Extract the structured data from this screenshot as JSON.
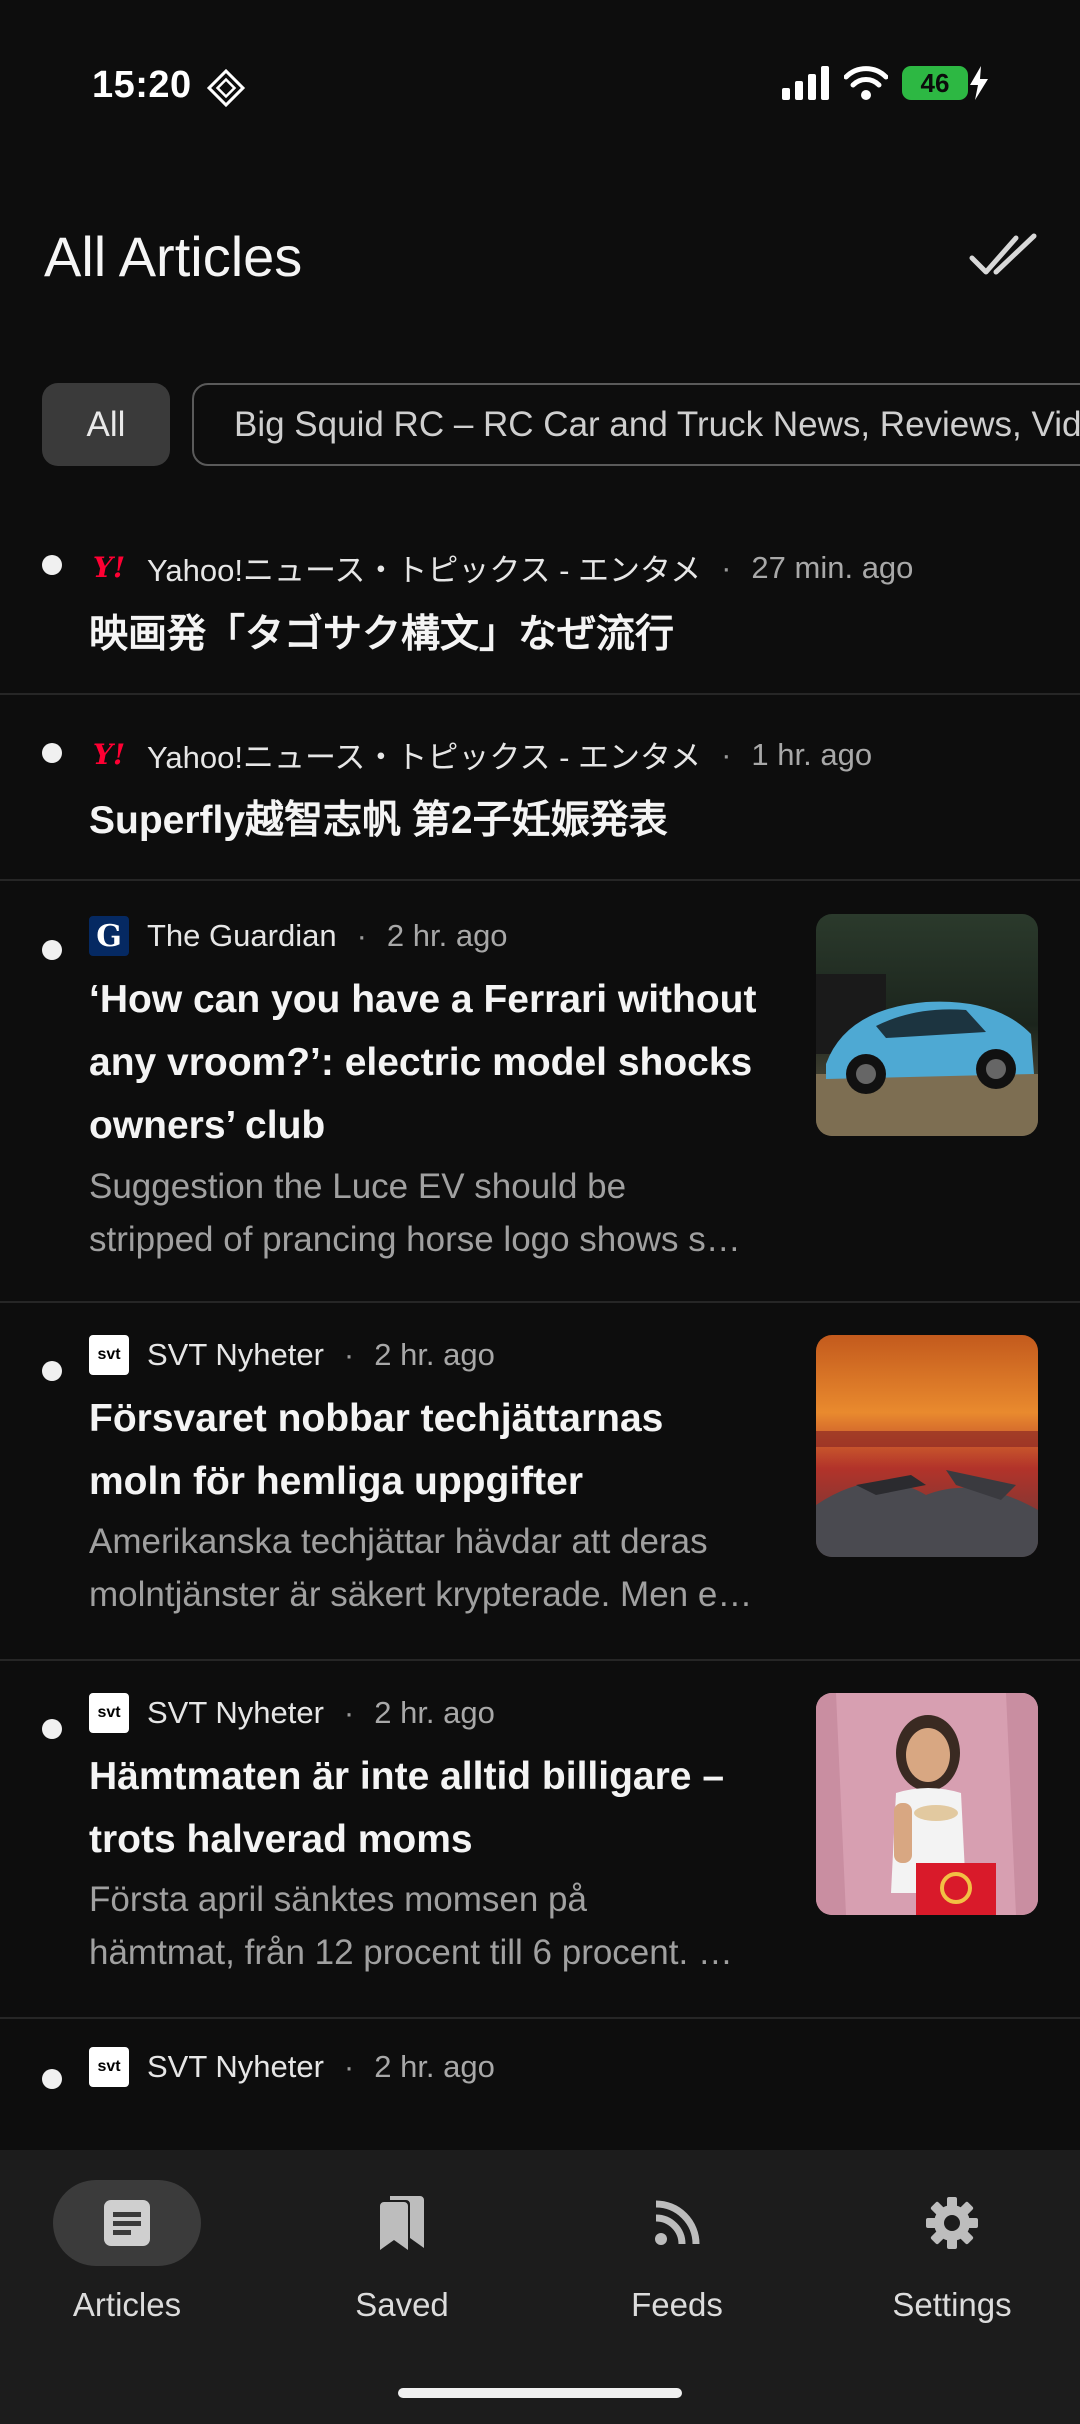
{
  "status_bar": {
    "time": "15:20",
    "battery": "46"
  },
  "header": {
    "title": "All Articles"
  },
  "filters": [
    {
      "label": "All",
      "selected": true
    },
    {
      "label": "Big Squid RC – RC Car and Truck News, Reviews, Videos, and More!",
      "selected": false
    }
  ],
  "articles": [
    {
      "source": "Yahoo!ニュース・トピックス - エンタメ",
      "time": "27 min. ago",
      "headline_lines": [
        "映画発「タゴサク構文」なぜ流行"
      ],
      "summary_lines": []
    },
    {
      "source": "Yahoo!ニュース・トピックス - エンタメ",
      "time": "1 hr. ago",
      "headline_lines": [
        "Superfly越智志帆 第2子妊娠発表"
      ],
      "summary_lines": []
    },
    {
      "source": "The Guardian",
      "time": "2 hr. ago",
      "headline_lines": [
        "‘How can you have a Ferrari without",
        "any vroom?’: electric model shocks",
        "owners’ club"
      ],
      "summary_lines": [
        "Suggestion the Luce EV should be",
        "stripped of prancing horse logo shows s…"
      ]
    },
    {
      "source": "SVT Nyheter",
      "time": "2 hr. ago",
      "headline_lines": [
        "Försvaret nobbar techjättarnas",
        "moln för hemliga uppgifter"
      ],
      "summary_lines": [
        "Amerikanska techjättar hävdar att deras",
        "molntjänster är säkert krypterade. Men e…"
      ]
    },
    {
      "source": "SVT Nyheter",
      "time": "2 hr. ago",
      "headline_lines": [
        "Hämtmaten är inte alltid billigare –",
        "trots halverad moms"
      ],
      "summary_lines": [
        "Första april sänktes momsen på",
        "hämtmat, från 12 procent till 6 procent. …"
      ]
    },
    {
      "source": "SVT Nyheter",
      "time": "2 hr. ago",
      "headline_lines": [],
      "summary_lines": []
    }
  ],
  "source_icons": {
    "yahoo": "Y!",
    "guardian": "G",
    "svt": "svt"
  },
  "bottom_nav": [
    {
      "label": "Articles",
      "icon": "article-icon",
      "active": true
    },
    {
      "label": "Saved",
      "icon": "bookmark-icon",
      "active": false
    },
    {
      "label": "Feeds",
      "icon": "rss-icon",
      "active": false
    },
    {
      "label": "Settings",
      "icon": "gear-icon",
      "active": false
    }
  ],
  "colors": {
    "background": "#0d0d0d",
    "battery": "#2db843",
    "yahoo_red": "#ff0033",
    "guardian_blue": "#052962"
  }
}
